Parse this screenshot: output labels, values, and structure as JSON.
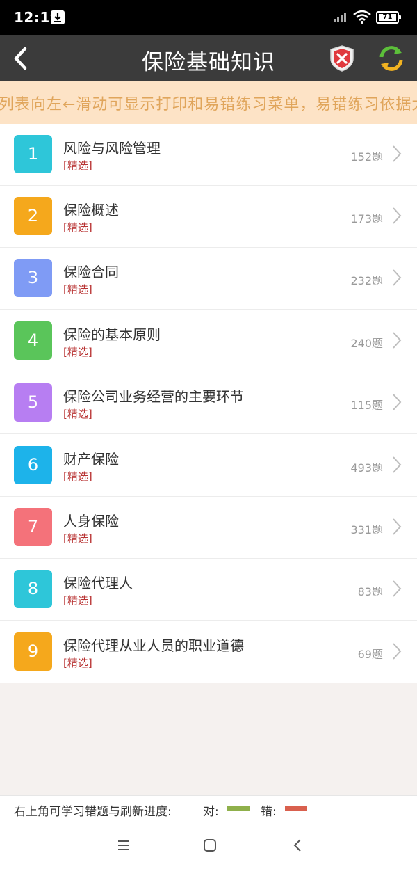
{
  "status": {
    "time": "12:19",
    "battery": "71"
  },
  "header": {
    "title": "保险基础知识"
  },
  "marquee": "列表向左←滑动可显示打印和易错练习菜单，易错练习依据大数",
  "colors": {
    "header_bg": "#3b3b3b",
    "marquee_bg": "#fde3c6",
    "tag": "#b83232",
    "right": "#8fb04b",
    "wrong": "#d9604e"
  },
  "chapters": [
    {
      "num": "1",
      "title": "风险与风险管理",
      "tag": "[精选]",
      "count": "152题",
      "color": "#2ec6d9"
    },
    {
      "num": "2",
      "title": "保险概述",
      "tag": "[精选]",
      "count": "173题",
      "color": "#f5a81c"
    },
    {
      "num": "3",
      "title": "保险合同",
      "tag": "[精选]",
      "count": "232题",
      "color": "#7f9bf5"
    },
    {
      "num": "4",
      "title": "保险的基本原则",
      "tag": "[精选]",
      "count": "240题",
      "color": "#5ac55a"
    },
    {
      "num": "5",
      "title": "保险公司业务经营的主要环节",
      "tag": "[精选]",
      "count": "115题",
      "color": "#b77ef2"
    },
    {
      "num": "6",
      "title": "财产保险",
      "tag": "[精选]",
      "count": "493题",
      "color": "#1db3ea"
    },
    {
      "num": "7",
      "title": "人身保险",
      "tag": "[精选]",
      "count": "331题",
      "color": "#f4727a"
    },
    {
      "num": "8",
      "title": "保险代理人",
      "tag": "[精选]",
      "count": "83题",
      "color": "#2ec6d9"
    },
    {
      "num": "9",
      "title": "保险代理从业人员的职业道德",
      "tag": "[精选]",
      "count": "69题",
      "color": "#f5a81c"
    }
  ],
  "footer": {
    "hint": "右上角可学习错题与刷新进度:",
    "right_label": "对:",
    "wrong_label": "错:"
  },
  "icons": {
    "back": "back-arrow-icon",
    "wrong_questions": "shield-x-icon",
    "refresh": "refresh-icon",
    "chevron": "chevron-right-icon",
    "nav_menu": "menu-icon",
    "nav_home": "home-icon",
    "nav_back": "back-icon"
  }
}
